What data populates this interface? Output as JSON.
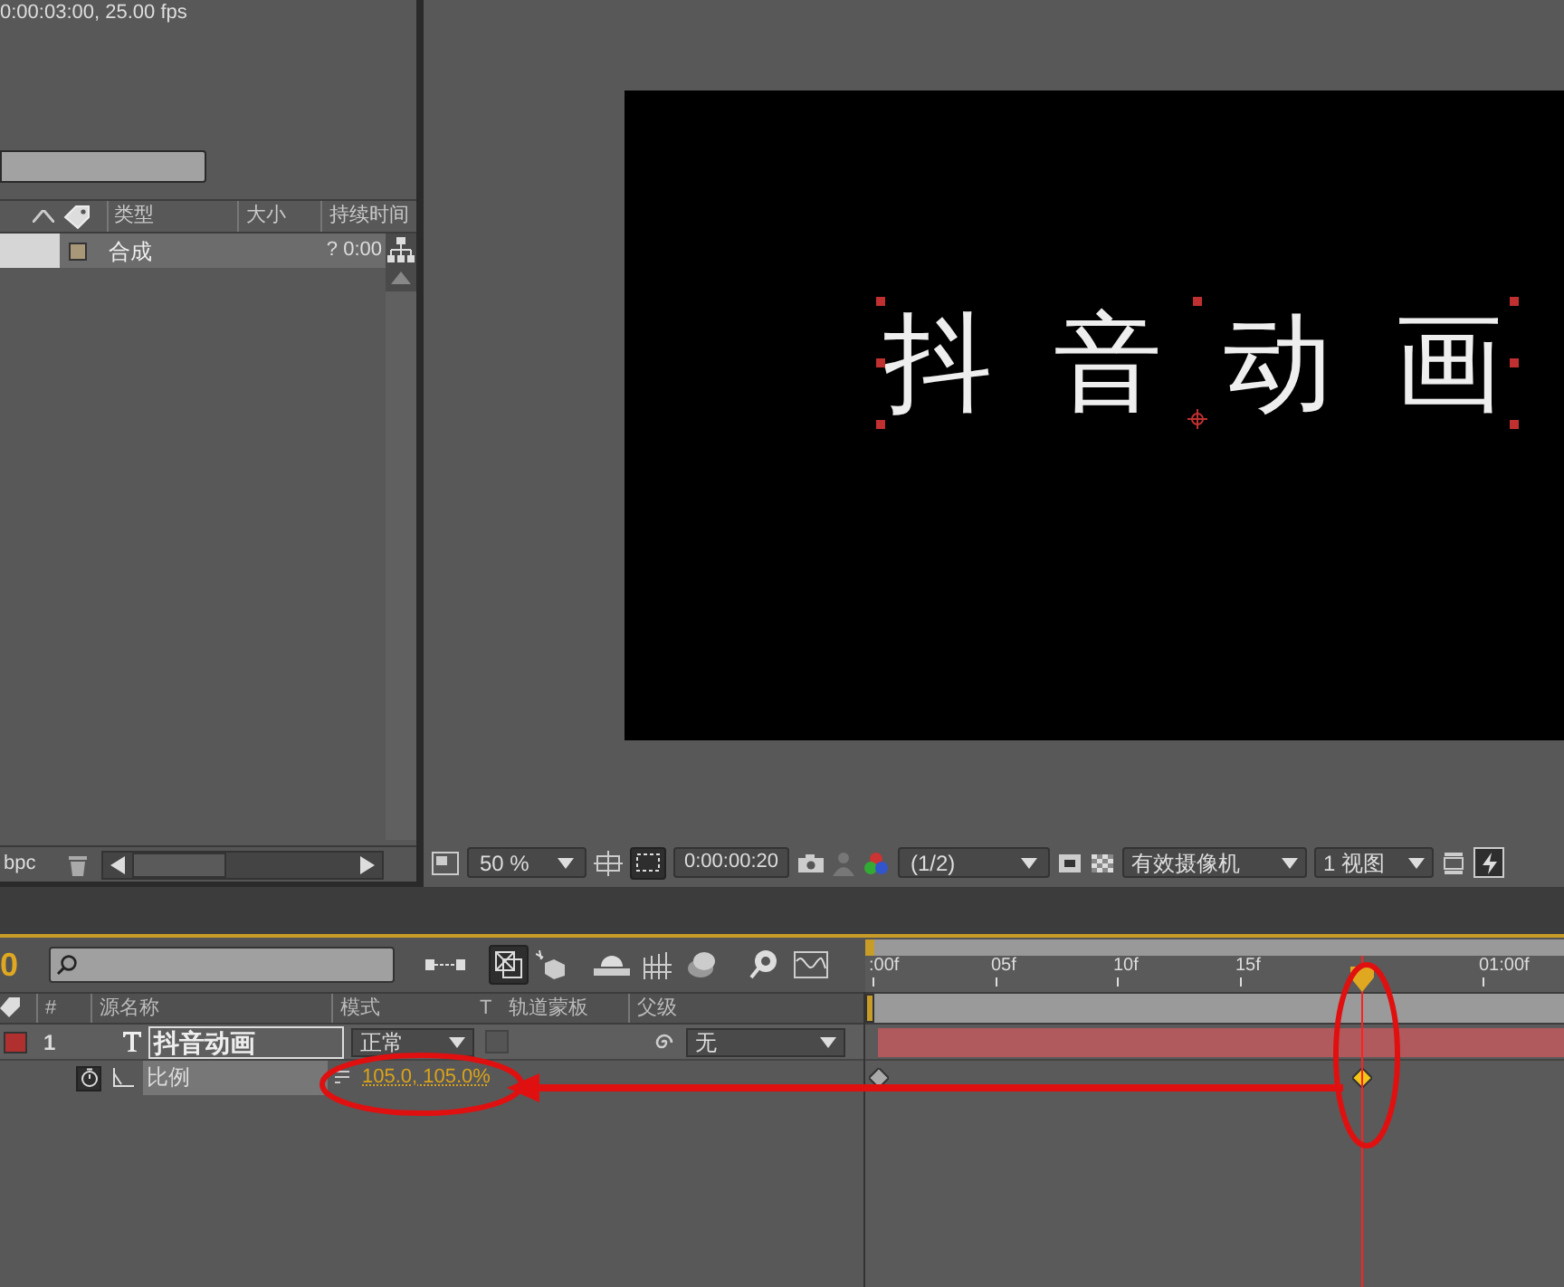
{
  "project": {
    "info": "0:00:03:00, 25.00 fps",
    "columns": [
      "类型",
      "大小",
      "持续时间"
    ],
    "items": [
      {
        "type": "合成",
        "duration": "? 0:00",
        "selected": true,
        "color": "#a89878"
      }
    ],
    "bit_depth": "bpc"
  },
  "viewer": {
    "comp_text": "抖音动画",
    "zoom": "50 %",
    "timecode": "0:00:00:20",
    "resolution": "(1/2)",
    "camera": "有效摄像机",
    "views": "1 视图"
  },
  "timeline": {
    "current_time": "0",
    "columns": [
      "#",
      "源名称",
      "模式",
      "T",
      "轨道蒙板",
      "父级"
    ],
    "ruler": [
      ":00f",
      "05f",
      "10f",
      "15f",
      "01:00f"
    ],
    "layers": [
      {
        "index": "1",
        "name": "抖音动画",
        "mode": "正常",
        "preserve_transparency": false,
        "parent": "无",
        "color": "#b03030",
        "properties": [
          {
            "name": "比例",
            "value": "105.0, 105.0%"
          }
        ]
      }
    ]
  }
}
